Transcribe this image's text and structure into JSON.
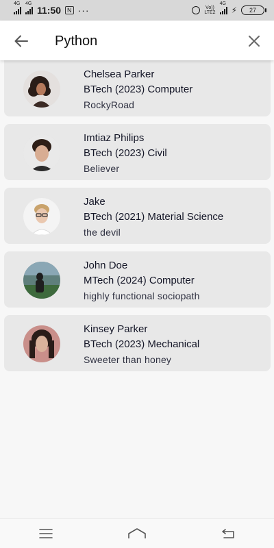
{
  "status_bar": {
    "network_1": "4G",
    "network_2": "4G",
    "time": "11:50",
    "badge": "N",
    "more": "···",
    "volte_top": "Vo))",
    "volte_bottom": "LTE2",
    "network_3": "4G",
    "battery": "27"
  },
  "header": {
    "search_value": "Python"
  },
  "results": [
    {
      "name": "Chelsea Parker",
      "program": "BTech (2023) Computer",
      "bio": "RockyRoad",
      "avatar": "avatar-curly-hair"
    },
    {
      "name": "Imtiaz Philips",
      "program": "BTech (2023) Civil",
      "bio": "Believer",
      "avatar": "avatar-young-man"
    },
    {
      "name": "Jake",
      "program": "BTech (2021) Material Science",
      "bio": "the devil",
      "avatar": "avatar-glasses-man"
    },
    {
      "name": "John Doe",
      "program": "MTech (2024) Computer",
      "bio": "highly functional sociopath",
      "avatar": "avatar-stadium-person"
    },
    {
      "name": "Kinsey Parker",
      "program": "BTech (2023) Mechanical",
      "bio": "Sweeter than honey",
      "avatar": "avatar-woman-portrait"
    }
  ],
  "colors": {
    "card_bg": "#e8e8e8",
    "page_bg": "#f7f7f7",
    "text": "#141627"
  }
}
